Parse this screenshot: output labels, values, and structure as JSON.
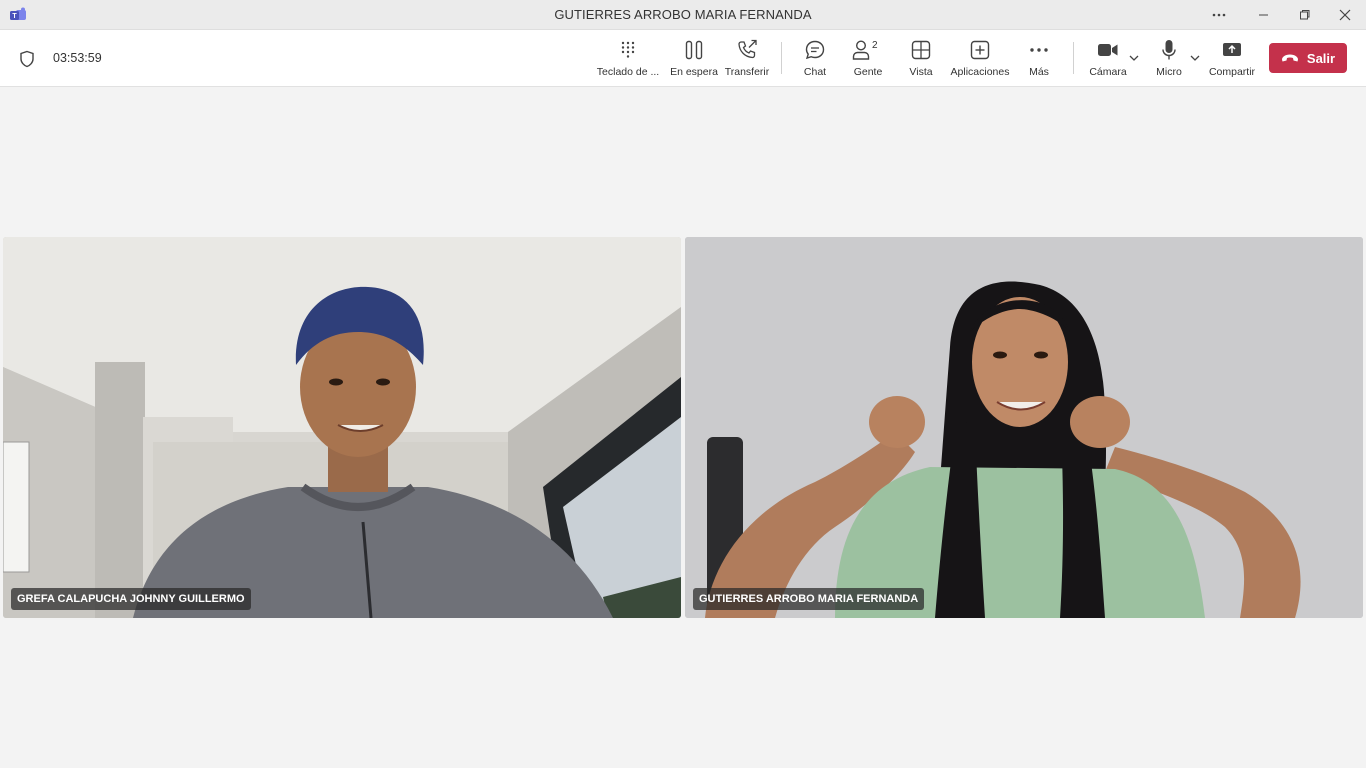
{
  "window": {
    "title": "GUTIERRES ARROBO MARIA FERNANDA",
    "controls": [
      "more-options",
      "minimize",
      "restore",
      "close"
    ]
  },
  "call": {
    "elapsed": "03:53:59"
  },
  "toolbar": {
    "dialpad_label": "Teclado de ...",
    "hold_label": "En espera",
    "transfer_label": "Transferir",
    "chat_label": "Chat",
    "people_label": "Gente",
    "people_count": "2",
    "view_label": "Vista",
    "apps_label": "Aplicaciones",
    "more_label": "Más",
    "camera_label": "Cámara",
    "mic_label": "Micro",
    "share_label": "Compartir",
    "leave_label": "Salir"
  },
  "participants": [
    {
      "name": "GREFA CALAPUCHA JOHNNY GUILLERMO"
    },
    {
      "name": "GUTIERRES ARROBO MARIA FERNANDA"
    }
  ],
  "colors": {
    "leave": "#c4314b",
    "titlebar": "#ebebeb",
    "stage": "#f3f3f3",
    "teams_brand": "#5b5fc7"
  },
  "icons": [
    "teams-logo-icon",
    "shield-icon",
    "dialpad-icon",
    "hold-icon",
    "transfer-icon",
    "chat-icon",
    "people-icon",
    "view-icon",
    "apps-icon",
    "more-icon",
    "camera-icon",
    "mic-icon",
    "share-icon",
    "phone-hangup-icon"
  ]
}
